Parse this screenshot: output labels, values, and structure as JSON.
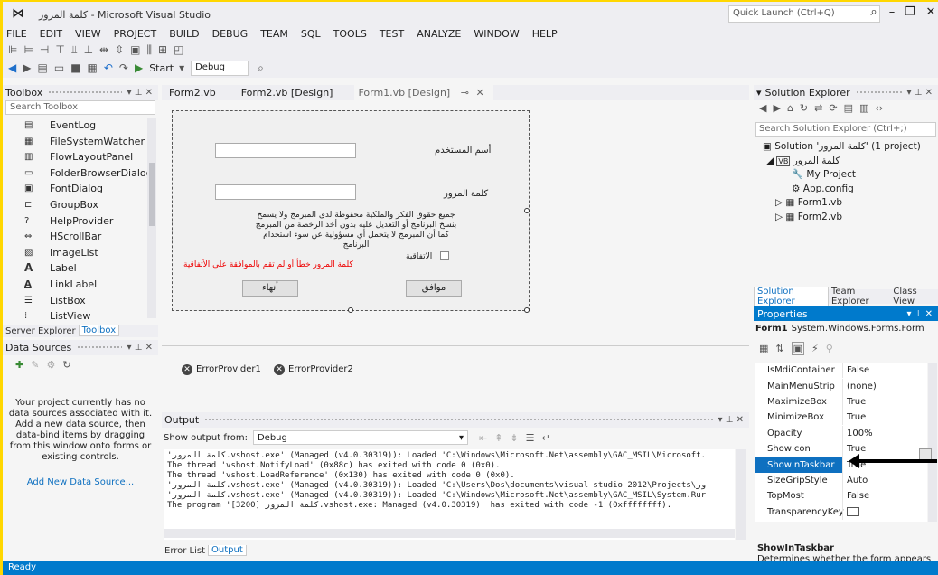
{
  "window": {
    "title": "كلمة المرور - Microsoft Visual Studio",
    "quick_launch_placeholder": "Quick Launch (Ctrl+Q)"
  },
  "menu": [
    "FILE",
    "EDIT",
    "VIEW",
    "PROJECT",
    "BUILD",
    "DEBUG",
    "TEAM",
    "SQL",
    "TOOLS",
    "TEST",
    "ANALYZE",
    "WINDOW",
    "HELP"
  ],
  "toolbar": {
    "start_label": "Start",
    "config_value": "Debug"
  },
  "toolbox": {
    "title": "Toolbox",
    "search_placeholder": "Search Toolbox",
    "items": [
      {
        "label": "EventLog",
        "icon": "eventlog-icon"
      },
      {
        "label": "FileSystemWatcher",
        "icon": "filesystemwatcher-icon"
      },
      {
        "label": "FlowLayoutPanel",
        "icon": "flowlayoutpanel-icon"
      },
      {
        "label": "FolderBrowserDialog",
        "icon": "folderbrowserdialog-icon"
      },
      {
        "label": "FontDialog",
        "icon": "fontdialog-icon"
      },
      {
        "label": "GroupBox",
        "icon": "groupbox-icon"
      },
      {
        "label": "HelpProvider",
        "icon": "helpprovider-icon"
      },
      {
        "label": "HScrollBar",
        "icon": "hscrollbar-icon"
      },
      {
        "label": "ImageList",
        "icon": "imagelist-icon"
      },
      {
        "label": "Label",
        "icon": "label-icon"
      },
      {
        "label": "LinkLabel",
        "icon": "linklabel-icon"
      },
      {
        "label": "ListBox",
        "icon": "listbox-icon"
      },
      {
        "label": "ListView",
        "icon": "listview-icon"
      }
    ],
    "tabs": [
      "Server Explorer",
      "Toolbox"
    ]
  },
  "data_sources": {
    "title": "Data Sources",
    "message": "Your project currently has no data sources associated with it. Add a new data source, then data-bind items by dragging from this window onto forms or existing controls.",
    "link": "Add New Data Source..."
  },
  "doc_tabs": [
    {
      "label": "Form2.vb"
    },
    {
      "label": "Form2.vb [Design]"
    },
    {
      "label": "Form1.vb [Design]"
    }
  ],
  "form1": {
    "username_label": "أسم المستخدم",
    "password_label": "كلمة المرور",
    "notice": "جميع حقوق الفكر والملكية محفوظة لدى المبرمج ولا يسمح بنسخ البرنامج أو التعديل عليه بدون أخذ الرخصة من المبرمج كما أن المبرمج لا يتحمل أي مسؤولية عن سوء استخدام البرنامج",
    "error_message": "كلمة المرور خطأ أو لم تقم بالموافقة على الأتفاقية",
    "agreement_label": "الاتفاقية",
    "ok_button": "موافق",
    "cancel_button": "أنهاء"
  },
  "tray": [
    "ErrorProvider1",
    "ErrorProvider2"
  ],
  "output": {
    "title": "Output",
    "show_from_label": "Show output from:",
    "show_from_value": "Debug",
    "lines": [
      "'كلمة المرور.vshost.exe' (Managed (v4.0.30319)): Loaded 'C:\\Windows\\Microsoft.Net\\assembly\\GAC_MSIL\\Microsoft.",
      "The thread 'vshost.NotifyLoad' (0x88c) has exited with code 0 (0x0).",
      "The thread 'vshost.LoadReference' (0x130) has exited with code 0 (0x0).",
      "'كلمة المرور.vshost.exe' (Managed (v4.0.30319)): Loaded 'C:\\Users\\Dos\\documents\\visual studio 2012\\Projects\\ور",
      "'كلمة المرور.vshost.exe' (Managed (v4.0.30319)): Loaded 'C:\\Windows\\Microsoft.Net\\assembly\\GAC_MSIL\\System.Rur",
      "The program '[3200] كلمة المرور.vshost.exe: Managed (v4.0.30319)' has exited with code -1 (0xffffffff)."
    ],
    "tabs": [
      "Error List",
      "Output"
    ]
  },
  "solution_explorer": {
    "title": "Solution Explorer",
    "search_placeholder": "Search Solution Explorer (Ctrl+;)",
    "solution_node": "Solution 'كلمة المرور' (1 project)",
    "project_node": "كلمة المرور",
    "children": [
      "My Project",
      "App.config",
      "Form1.vb",
      "Form2.vb"
    ],
    "tabs": [
      "Solution Explorer",
      "Team Explorer",
      "Class View"
    ]
  },
  "properties": {
    "title": "Properties",
    "object_name": "Form1",
    "object_type": "System.Windows.Forms.Form",
    "rows": [
      {
        "name": "IsMdiContainer",
        "value": "False"
      },
      {
        "name": "MainMenuStrip",
        "value": "(none)"
      },
      {
        "name": "MaximizeBox",
        "value": "True"
      },
      {
        "name": "MinimizeBox",
        "value": "True"
      },
      {
        "name": "Opacity",
        "value": "100%"
      },
      {
        "name": "ShowIcon",
        "value": "True"
      },
      {
        "name": "ShowInTaskbar",
        "value": "True"
      },
      {
        "name": "SizeGripStyle",
        "value": "Auto"
      },
      {
        "name": "TopMost",
        "value": "False"
      },
      {
        "name": "TransparencyKey",
        "value": ""
      }
    ],
    "desc_title": "ShowInTaskbar",
    "desc_text": "Determines whether the form appears in the Windows Taskbar."
  },
  "status": {
    "text": "Ready"
  }
}
